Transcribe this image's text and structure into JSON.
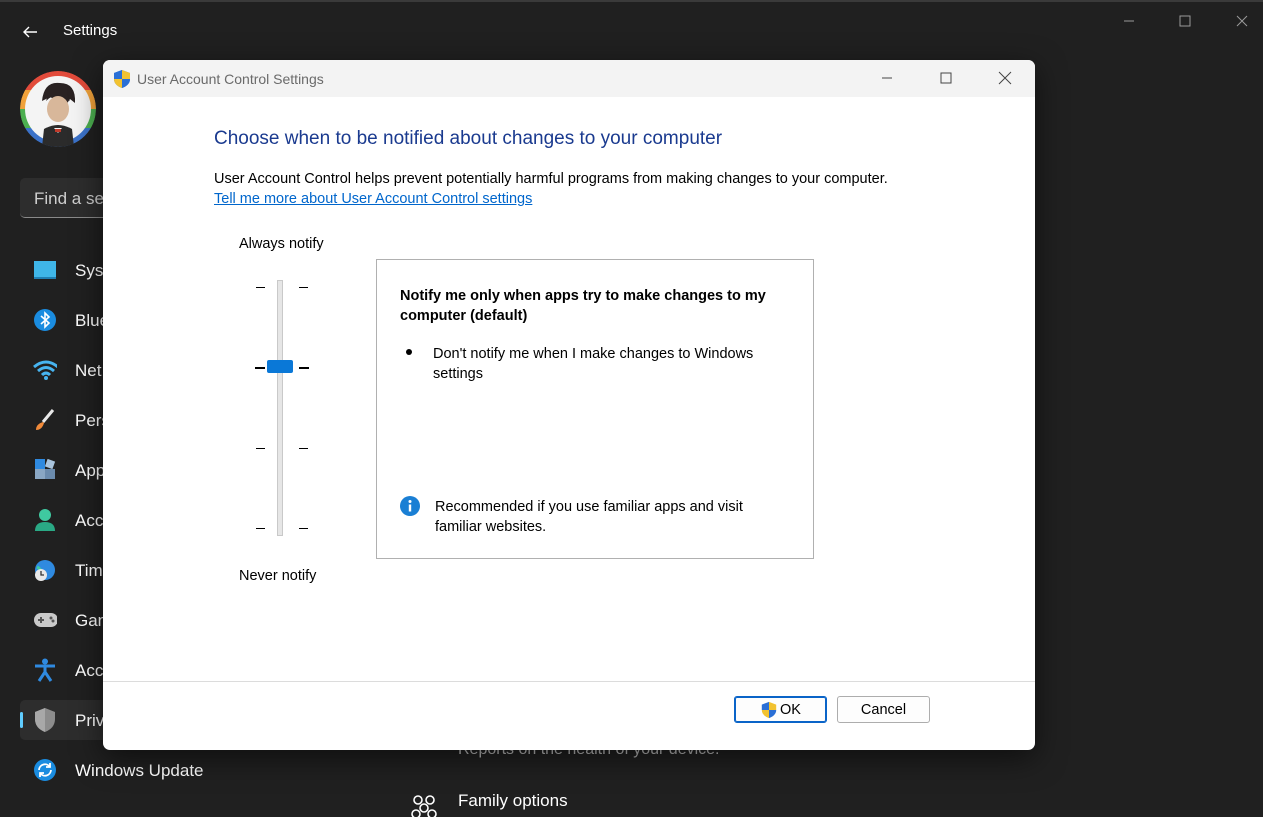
{
  "settings": {
    "title": "Settings",
    "search_placeholder": "Find a se",
    "nav": [
      {
        "label": "Syst",
        "icon": "system-icon"
      },
      {
        "label": "Blue",
        "icon": "bluetooth-icon"
      },
      {
        "label": "Net",
        "icon": "wifi-icon"
      },
      {
        "label": "Pers",
        "icon": "paintbrush-icon"
      },
      {
        "label": "App",
        "icon": "apps-icon"
      },
      {
        "label": "Acc",
        "icon": "account-icon"
      },
      {
        "label": "Tim",
        "icon": "time-language-icon"
      },
      {
        "label": "Gan",
        "icon": "gamepad-icon"
      },
      {
        "label": "Acc",
        "icon": "accessibility-icon"
      },
      {
        "label": "Priv",
        "icon": "shield-icon"
      },
      {
        "label": "Windows Update",
        "icon": "update-icon"
      }
    ],
    "bg_subtext": "Reports on the health of your device.",
    "bg_family": "Family options"
  },
  "uac": {
    "title": "User Account Control Settings",
    "heading": "Choose when to be notified about changes to your computer",
    "description": "User Account Control helps prevent potentially harmful programs from making changes to your computer.",
    "link": "Tell me more about User Account Control settings",
    "always_label": "Always notify",
    "never_label": "Never notify",
    "slider_level": 3,
    "slider_levels": 4,
    "panel_title": "Notify me only when apps try to make changes to my computer (default)",
    "bullet": "Don't notify me when I make changes to Windows settings",
    "recommendation": "Recommended if you use familiar apps and visit familiar websites.",
    "ok_label": "OK",
    "cancel_label": "Cancel"
  },
  "colors": {
    "accent": "#60cdff",
    "heading_blue": "#1a3a8f",
    "link_blue": "#0066cc",
    "slider_thumb": "#0a78d7"
  }
}
